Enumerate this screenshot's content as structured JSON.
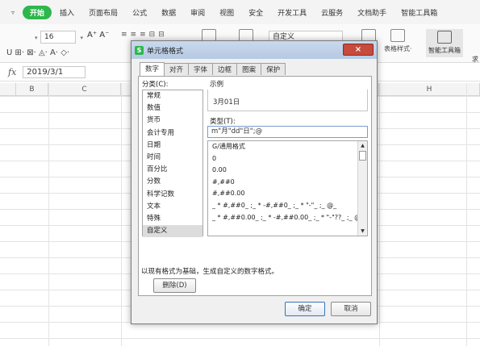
{
  "menubar": {
    "caret": "▿",
    "start_label": "开始",
    "items": [
      "插入",
      "页面布局",
      "公式",
      "数据",
      "审阅",
      "视图",
      "安全",
      "开发工具",
      "云服务",
      "文档助手",
      "智能工具箱"
    ]
  },
  "ribbon": {
    "font_size": "16",
    "grow_shrink": "A⁺ A⁻",
    "row2": "U ⊞· ⊠· ◬· A· ◇·",
    "number_format": "自定义",
    "table_style_label": "表格样式·",
    "smart_toolbox_label": "智能工具箱",
    "smart_tail": "求"
  },
  "formulabar": {
    "fx": "fx",
    "value": "2019/3/1"
  },
  "sheet": {
    "columns": [
      "B",
      "C",
      "H"
    ]
  },
  "dialog": {
    "title": "单元格格式",
    "logo": "S",
    "close": "×",
    "tabs": [
      "数字",
      "对齐",
      "字体",
      "边框",
      "图案",
      "保护"
    ],
    "category_label": "分类(C):",
    "categories": [
      "常规",
      "数值",
      "货币",
      "会计专用",
      "日期",
      "时间",
      "百分比",
      "分数",
      "科学记数",
      "文本",
      "特殊",
      "自定义"
    ],
    "selected_category": "自定义",
    "sample_label": "示例",
    "sample_value": "3月01日",
    "type_label": "类型(T):",
    "type_value": "m\"月\"dd\"日\";@",
    "formats": [
      "G/通用格式",
      "0",
      "0.00",
      "#,##0",
      "#,##0.00",
      "_ * #,##0_ ;_ * -#,##0_ ;_ * \"-\"_ ;_ @_",
      "_ * #,##0.00_ ;_ * -#,##0.00_ ;_ * \"-\"??_ ;_ @_"
    ],
    "delete_label": "删除(D)",
    "hint": "以现有格式为基础，生成自定义的数字格式。",
    "ok_label": "确定",
    "cancel_label": "取消"
  }
}
